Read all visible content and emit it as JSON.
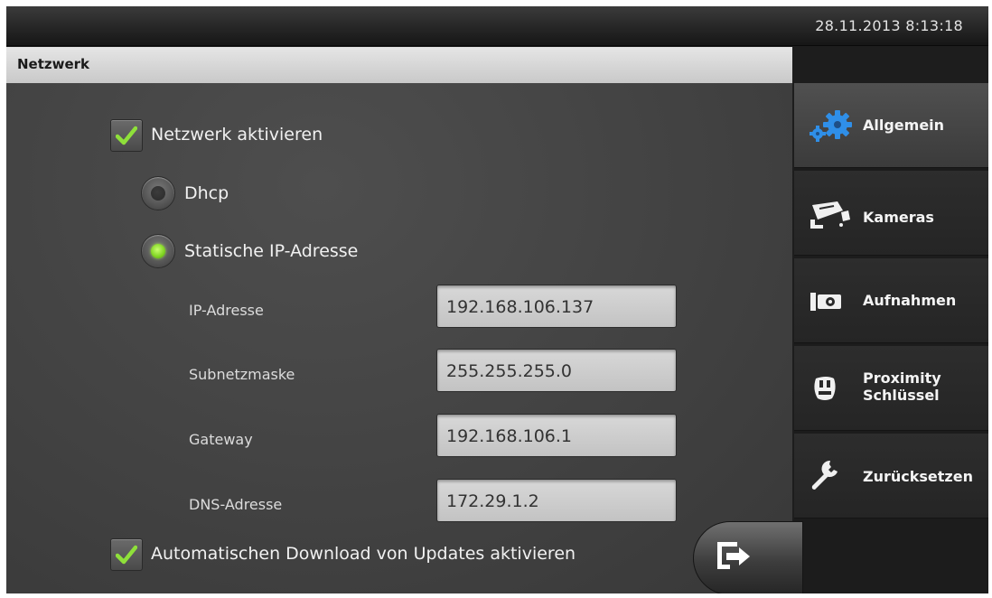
{
  "topbar": {
    "datetime": "28.11.2013 8:13:18"
  },
  "header": {
    "title": "Netzwerk"
  },
  "form": {
    "enable_network": {
      "label": "Netzwerk aktivieren",
      "checked": true
    },
    "dhcp": {
      "label": "Dhcp",
      "selected": false
    },
    "static_ip": {
      "label": "Statische IP-Adresse",
      "selected": true
    },
    "ip": {
      "label": "IP-Adresse",
      "value": "192.168.106.137"
    },
    "subnet": {
      "label": "Subnetzmaske",
      "value": "255.255.255.0"
    },
    "gateway": {
      "label": "Gateway",
      "value": "192.168.106.1"
    },
    "dns": {
      "label": "DNS-Adresse",
      "value": "172.29.1.2"
    },
    "auto_update": {
      "label": "Automatischen Download von Updates aktivieren",
      "checked": true
    }
  },
  "sidebar": {
    "items": [
      {
        "label": "Allgemein",
        "icon": "gears-icon",
        "active": true
      },
      {
        "label": "Kameras",
        "icon": "camera-icon",
        "active": false
      },
      {
        "label": "Aufnahmen",
        "icon": "recordings-icon",
        "active": false
      },
      {
        "label_line1": "Proximity",
        "label_line2": "Schlüssel",
        "icon": "key-tag-icon",
        "active": false
      },
      {
        "label": "Zurücksetzen",
        "icon": "wrench-icon",
        "active": false
      }
    ]
  },
  "colors": {
    "accent_green": "#7fd321",
    "active_nav": "#4a4a4a"
  }
}
